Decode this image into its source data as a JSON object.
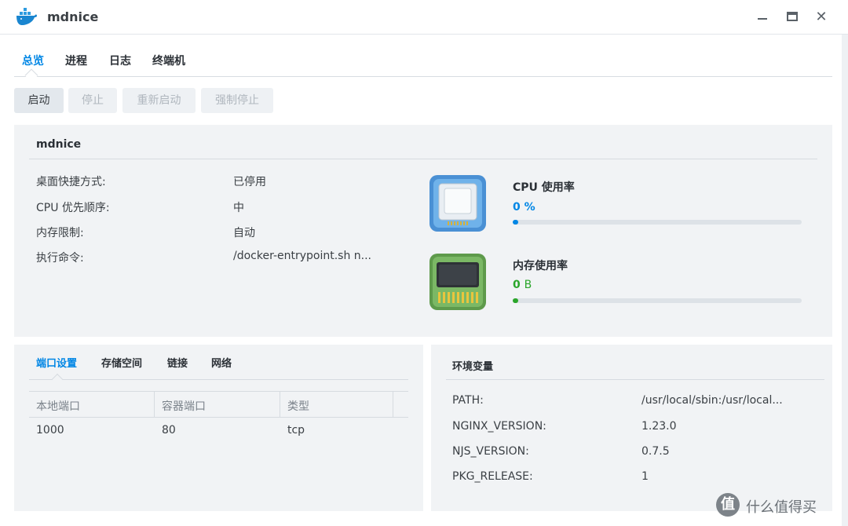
{
  "window": {
    "title": "mdnice",
    "app_icon": "docker-whale-icon",
    "controls": [
      "minimize-icon",
      "maximize-icon",
      "close-icon"
    ]
  },
  "tabs": [
    {
      "label": "总览",
      "active": true
    },
    {
      "label": "进程",
      "active": false
    },
    {
      "label": "日志",
      "active": false
    },
    {
      "label": "终端机",
      "active": false
    }
  ],
  "toolbar": {
    "start": "启动",
    "stop": "停止",
    "restart": "重新启动",
    "force_stop": "强制停止"
  },
  "overview": {
    "name": "mdnice",
    "rows": [
      {
        "label": "桌面快捷方式:",
        "value": "已停用"
      },
      {
        "label": "CPU 优先顺序:",
        "value": "中"
      },
      {
        "label": "内存限制:",
        "value": "自动"
      },
      {
        "label": "执行命令:",
        "value": "/docker-entrypoint.sh n..."
      }
    ],
    "cpu": {
      "title": "CPU 使用率",
      "value": "0",
      "unit": "%",
      "percent": 0,
      "color": "#0086e5",
      "icon": "cpu-chip-icon"
    },
    "memory": {
      "title": "内存使用率",
      "value": "0",
      "unit": "B",
      "percent": 0,
      "color": "#2aa52a",
      "icon": "memory-module-icon"
    }
  },
  "ports": {
    "subtabs": [
      {
        "label": "端口设置",
        "active": true
      },
      {
        "label": "存储空间",
        "active": false
      },
      {
        "label": "链接",
        "active": false
      },
      {
        "label": "网络",
        "active": false
      }
    ],
    "headers": [
      "本地端口",
      "容器端口",
      "类型"
    ],
    "rows": [
      [
        "1000",
        "80",
        "tcp"
      ]
    ]
  },
  "env": {
    "title": "环境变量",
    "vars": [
      {
        "key": "PATH:",
        "value": "/usr/local/sbin:/usr/local..."
      },
      {
        "key": "NGINX_VERSION:",
        "value": "1.23.0"
      },
      {
        "key": "NJS_VERSION:",
        "value": "0.7.5"
      },
      {
        "key": "PKG_RELEASE:",
        "value": "1"
      }
    ]
  },
  "watermark": {
    "mark": "值",
    "text": "什么值得买"
  },
  "colors": {
    "accent": "#0086e5",
    "memory": "#2aa52a",
    "panel": "#f1f3f5"
  }
}
